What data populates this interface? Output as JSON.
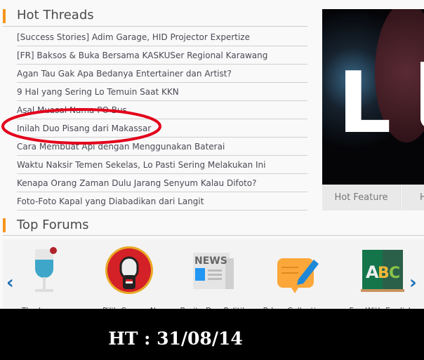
{
  "hot_threads": {
    "title": "Hot Threads",
    "items": [
      "[Success Stories] Adim Garage, HID Projector Expertize",
      "[FR] Baksos & Buka Bersama KASKUSer Regional Karawang",
      "Agan Tau Gak Apa Bedanya Entertainer dan Artist?",
      "9 Hal yang Sering Lo Temuin Saat KKN",
      "Asal Muasal Nama PO Bus",
      "Inilah Duo Pisang dari Makassar",
      "Cara Membuat Api dengan Menggunakan Baterai",
      "Waktu Naksir Temen Sekelas, Lo Pasti Sering Melakukan Ini",
      "Kenapa Orang Zaman Dulu Jarang Senyum Kalau Difoto?",
      "Foto-Foto Kapal yang Diabadikan dari Langit"
    ]
  },
  "feature": {
    "tabs": [
      "Hot Feature",
      "H"
    ]
  },
  "top_forums": {
    "title": "Top Forums",
    "items": [
      "The Lounge",
      "Pilih Capres N",
      "Berita Dan Politik",
      "B-Log Collections",
      "Fun With English"
    ]
  },
  "caption": "HT : 31/08/14",
  "colors": {
    "accent": "#f7941d",
    "annotation": "#e3001b",
    "arrow": "#1a6fb6"
  }
}
